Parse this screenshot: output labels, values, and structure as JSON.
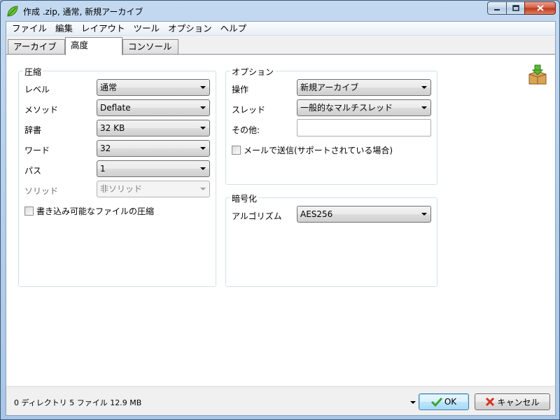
{
  "window": {
    "title": "作成 .zip, 通常, 新規アーカイブ"
  },
  "menu": [
    "ファイル",
    "編集",
    "レイアウト",
    "ツール",
    "オプション",
    "ヘルプ"
  ],
  "tabs": [
    {
      "label": "アーカイブ",
      "active": false
    },
    {
      "label": "高度",
      "active": true
    },
    {
      "label": "コンソール",
      "active": false
    }
  ],
  "compression": {
    "group_label": "圧縮",
    "level": {
      "label": "レベル",
      "value": "通常"
    },
    "method": {
      "label": "メソッド",
      "value": "Deflate"
    },
    "dictionary": {
      "label": "辞書",
      "value": "32 KB"
    },
    "word": {
      "label": "ワード",
      "value": "32"
    },
    "passes": {
      "label": "パス",
      "value": "1"
    },
    "solid": {
      "label": "ソリッド",
      "value": "非ソリッド",
      "disabled": true
    },
    "compress_writable": {
      "label": "書き込み可能なファイルの圧縮",
      "checked": false
    }
  },
  "options": {
    "group_label": "オプション",
    "operation": {
      "label": "操作",
      "value": "新規アーカイブ"
    },
    "threads": {
      "label": "スレッド",
      "value": "一般的なマルチスレッド"
    },
    "other": {
      "label": "その他:",
      "value": ""
    },
    "send_mail": {
      "label": "メールで送信(サポートされている場合)",
      "checked": false
    }
  },
  "encryption": {
    "group_label": "暗号化",
    "algorithm": {
      "label": "アルゴリズム",
      "value": "AES256"
    }
  },
  "status": {
    "summary": "0 ディレクトリ 5 ファイル 12.9 MB"
  },
  "buttons": {
    "ok": "OK",
    "cancel": "キャンセル"
  },
  "icons": {
    "app": "peazip-leaf-icon",
    "archive": "archive-box-icon",
    "ok": "green-check-icon",
    "cancel": "red-x-icon"
  }
}
